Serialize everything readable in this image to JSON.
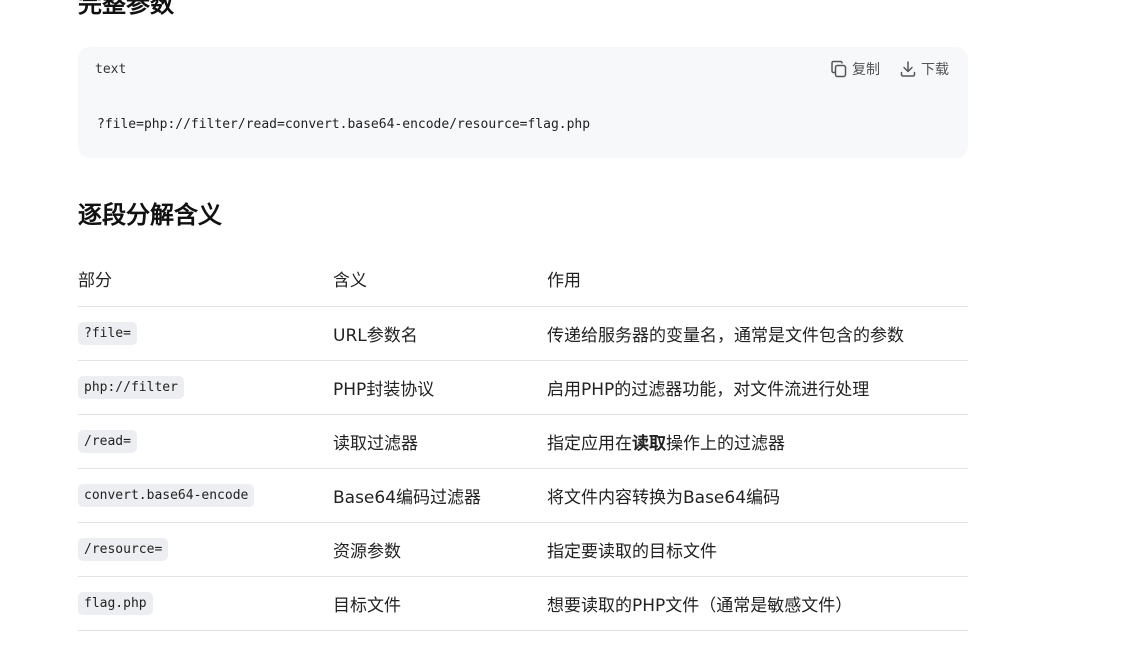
{
  "headings": {
    "top": "完整参数",
    "section": "逐段分解含义"
  },
  "codeblock": {
    "lang": "text",
    "copy_label": "复制",
    "download_label": "下载",
    "code": "?file=php://filter/read=convert.base64-encode/resource=flag.php"
  },
  "table": {
    "headers": [
      "部分",
      "含义",
      "作用"
    ],
    "rows": [
      {
        "part": "?file=",
        "meaning": "URL参数名",
        "effect_pre": "传递给服务器的变量名，通常是文件包含的参数",
        "effect_bold": "",
        "effect_post": ""
      },
      {
        "part": "php://filter",
        "meaning": "PHP封装协议",
        "effect_pre": "启用PHP的过滤器功能，对文件流进行处理",
        "effect_bold": "",
        "effect_post": ""
      },
      {
        "part": "/read=",
        "meaning": "读取过滤器",
        "effect_pre": "指定应用在",
        "effect_bold": "读取",
        "effect_post": "操作上的过滤器"
      },
      {
        "part": "convert.base64-encode",
        "meaning": "Base64编码过滤器",
        "effect_pre": "将文件内容转换为Base64编码",
        "effect_bold": "",
        "effect_post": ""
      },
      {
        "part": "/resource=",
        "meaning": "资源参数",
        "effect_pre": "指定要读取的目标文件",
        "effect_bold": "",
        "effect_post": ""
      },
      {
        "part": "flag.php",
        "meaning": "目标文件",
        "effect_pre": "想要读取的PHP文件（通常是敏感文件）",
        "effect_bold": "",
        "effect_post": ""
      }
    ]
  }
}
